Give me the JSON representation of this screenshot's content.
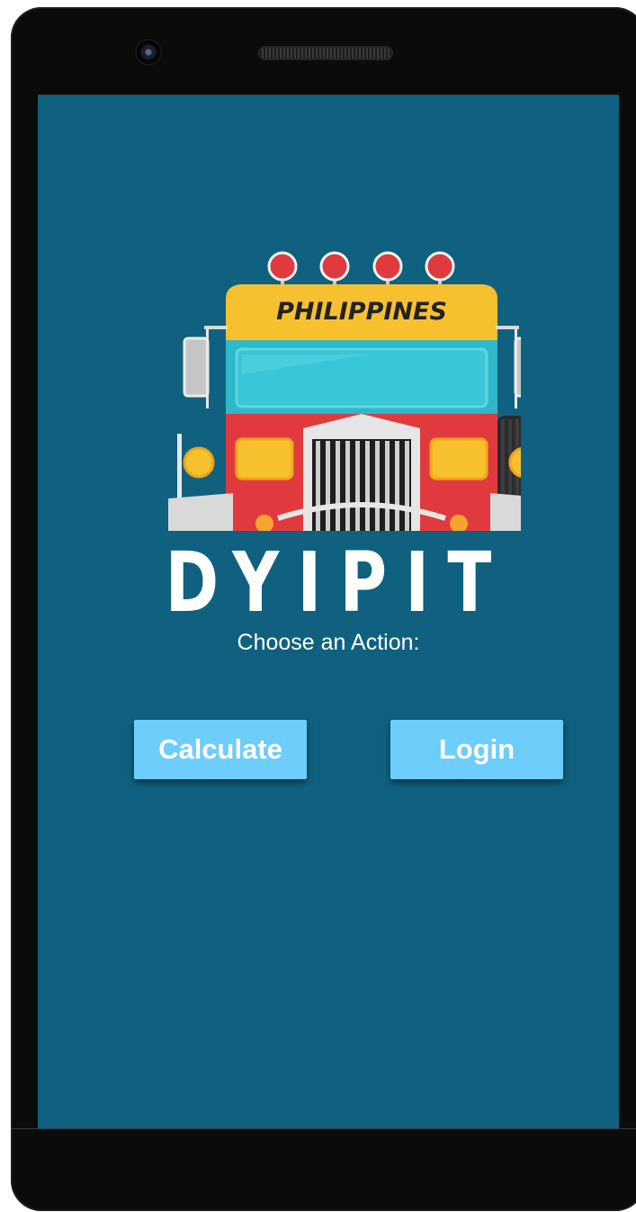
{
  "app": {
    "title": "DYIPIT",
    "prompt": "Choose an Action:",
    "logo_banner": "PHILIPPINES"
  },
  "actions": {
    "calculate_label": "Calculate",
    "login_label": "Login"
  },
  "colors": {
    "screen_background": "#0f617f",
    "button_background": "#6dcdfb",
    "button_text": "#ffffff",
    "jeep_red": "#e03a3e",
    "jeep_yellow": "#f6c02f",
    "jeep_teal": "#2fb8c9"
  },
  "icons": {
    "camera": "front-camera-icon",
    "speaker": "earpiece-speaker-icon",
    "logo": "jeepney-logo-icon"
  }
}
